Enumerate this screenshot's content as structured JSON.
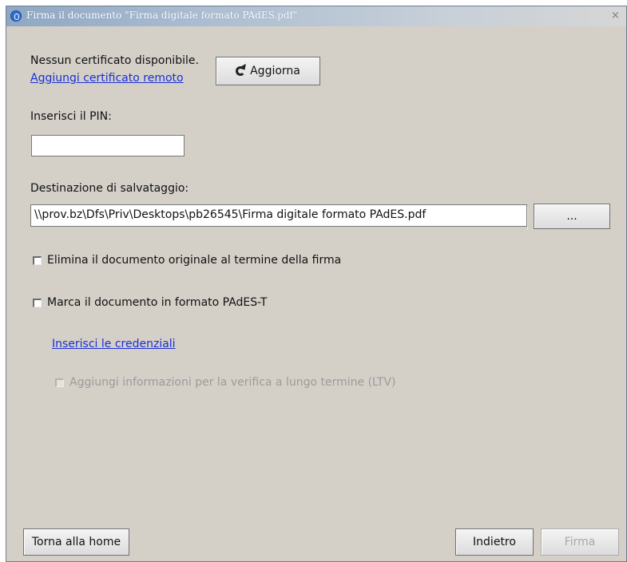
{
  "window": {
    "title": "Firma il documento \"Firma digitale formato PAdES.pdf\"",
    "close_glyph": "×"
  },
  "certificate": {
    "status_text": "Nessun certificato disponibile.",
    "add_remote_link": "Aggiungi certificato remoto",
    "refresh_button": "Aggiorna"
  },
  "pin": {
    "label": "Inserisci il PIN:",
    "value": ""
  },
  "destination": {
    "label": "Destinazione di salvataggio:",
    "path": "\\\\prov.bz\\Dfs\\Priv\\Desktops\\pb26545\\Firma digitale formato PAdES.pdf",
    "browse_button": "..."
  },
  "options": {
    "delete_original": "Elimina il documento originale al termine della firma",
    "mark_pades_t": "Marca il documento in formato PAdES-T",
    "credentials_link": "Inserisci le credenziali",
    "ltv": "Aggiungi informazioni per la verifica a lungo termine (LTV)"
  },
  "footer": {
    "home_button": "Torna alla home",
    "back_button": "Indietro",
    "sign_button": "Firma"
  },
  "colors": {
    "dialog_bg": "#d4d0c8",
    "link": "#1a2fd6",
    "disabled_text": "#9b9b9b"
  }
}
